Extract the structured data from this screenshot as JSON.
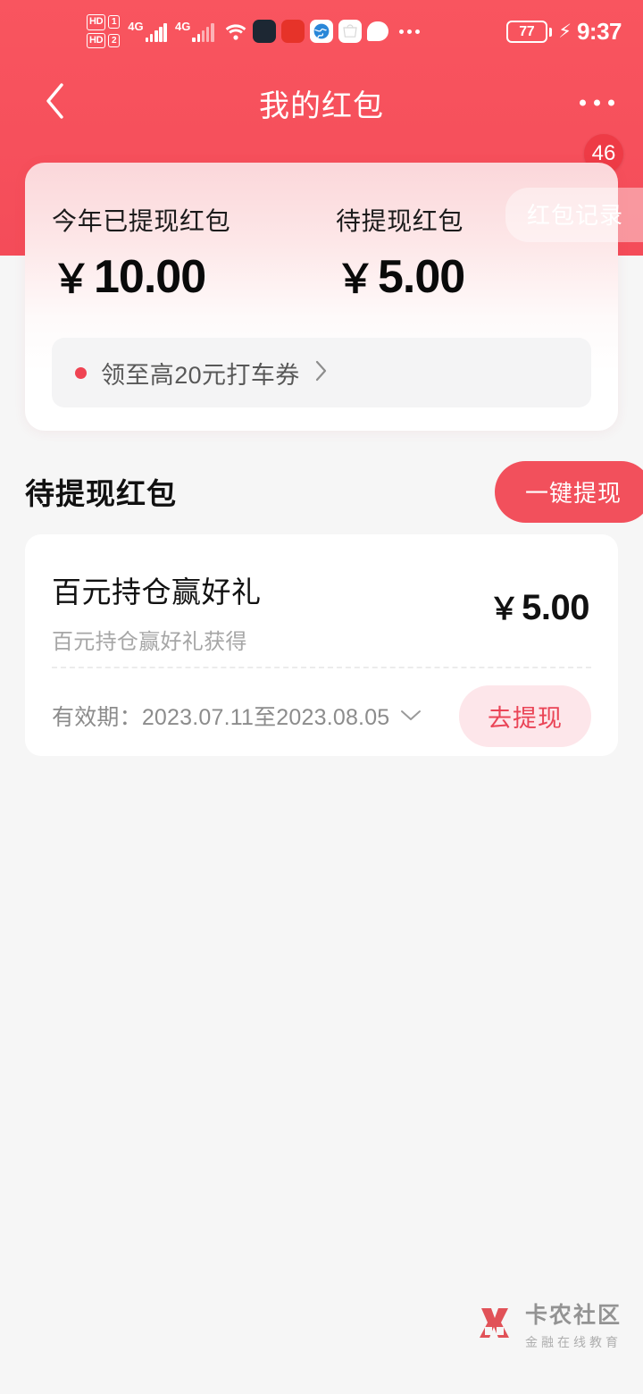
{
  "theme": {
    "brand_red": "#f2505c",
    "header_red": "#f6505c",
    "badge_red": "#ee3b46",
    "soft_pink": "#fde6ea",
    "page_bg": "#f6f6f6"
  },
  "status_bar": {
    "hd_label_1": "HD",
    "hd_label_2": "HD",
    "sim_1": "1",
    "sim_2": "2",
    "network_1": "4G",
    "network_2": "4G",
    "wifi_icon": "wifi-icon",
    "app_icons": [
      "app-icon-dark",
      "app-icon-red",
      "app-icon-globe",
      "app-icon-bag",
      "chat-bubble-icon"
    ],
    "overflow_icon": "status-more-icon",
    "battery_percent": "77",
    "charging_icon": "charging-bolt-icon",
    "time": "9:37"
  },
  "nav": {
    "back_icon": "chevron-left-icon",
    "title": "我的红包",
    "more_icon": "more-options-icon",
    "badge_count": "46"
  },
  "summary": {
    "record_button": "红包记录",
    "stats": [
      {
        "label": "今年已提现红包",
        "currency": "￥",
        "amount": "10.00"
      },
      {
        "label": "待提现红包",
        "currency": "￥",
        "amount": "5.00"
      }
    ],
    "promo": {
      "dot_icon": "red-dot-icon",
      "text": "领至高20元打车券",
      "chevron_icon": "chevron-right-icon"
    }
  },
  "section": {
    "title": "待提现红包",
    "action_button": "一键提现"
  },
  "coupons": [
    {
      "name": "百元持仓赢好礼",
      "subtitle": "百元持仓赢好礼获得",
      "currency": "￥",
      "amount": "5.00",
      "validity_label": "有效期：",
      "validity_range": "2023.07.11至2023.08.05",
      "expand_icon": "chevron-down-icon",
      "action_button": "去提现"
    }
  ],
  "watermark": {
    "logo_icon": "kanong-logo-icon",
    "title": "卡农社区",
    "subtitle": "金融在线教育"
  }
}
